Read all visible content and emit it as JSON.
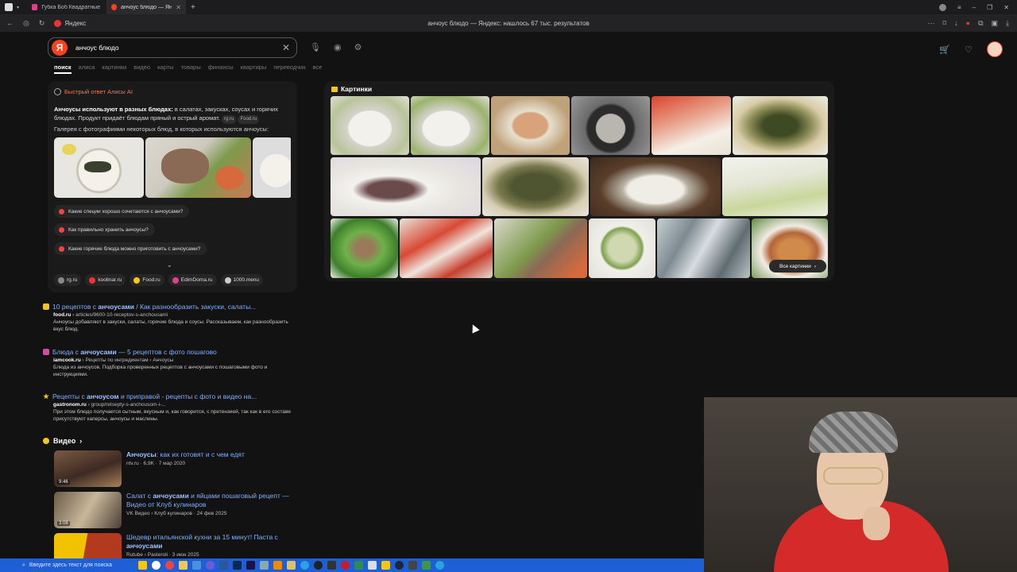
{
  "browser": {
    "tabs": [
      {
        "label": "Губка Боб Квадратные Ш"
      },
      {
        "label": "анчоус блюдо — Яндекс"
      }
    ],
    "site_label": "Яндекс",
    "page_title": "анчоус блюдо — Яндекс: нашлось 67 тыс. результатов"
  },
  "search": {
    "query": "анчоус блюдо",
    "logo": "Я"
  },
  "nav_tabs": [
    "поиск",
    "алиса",
    "картинки",
    "видео",
    "карты",
    "товары",
    "финансы",
    "квартиры",
    "переводчик",
    "все"
  ],
  "alice": {
    "header": "Быстрый ответ Алисы AI",
    "intro_bold": "Анчоусы используют в разных блюдах:",
    "intro_rest": " в салатах, закусках, соусах и горячих блюдах. Продукт придаёт блюдам пряный и острый аромат.",
    "chip1": "rg.ru",
    "chip2": "Food.ru",
    "gallery_caption": "Галерея с фотографиями некоторых блюд, в которых используются анчоусы:",
    "questions": [
      "Какие специи хорошо сочетаются с анчоусами?",
      "Как правильно хранить анчоусы?",
      "Какие горячие блюда можно приготовить с анчоусами?"
    ],
    "sources": [
      "rg.ru",
      "koolinar.ru",
      "Food.ru",
      "EdimDoma.ru",
      "1000.menu"
    ]
  },
  "results": [
    {
      "title_a": "10 рецептов с ",
      "title_b": "анчоусами",
      "title_c": " / Как разнообразить закуски, салаты...",
      "url_a": "food.ru",
      "url_b": " › articles/9600-10-receptov-s-anchousami",
      "desc": "Анчоусы добавляют в закуски, салаты, горячие блюда и соусы. Рассказываем, как разнообразить вкус блюд."
    },
    {
      "title_a": "Блюда с ",
      "title_b": "анчоусами",
      "title_c": " — 5 рецептов с фото пошагово",
      "url_a": "iamcook.ru",
      "url_b": " › Рецепты по ингредиентам › Анчоусы",
      "desc": "Блюда из анчоусов. Подборка проверенных рецептов с анчоусами с пошаговыми фото и инструкциями."
    },
    {
      "title_a": "Рецепты с ",
      "title_b": "анчоусом",
      "title_c": " и приправой - рецепты с фото и видео на...",
      "url_a": "gastronom.ru",
      "url_b": " › group/retsepty-s-anchousom-i-...",
      "desc": "При этом блюдо получается сытным, вкусным и, как говорится, с претензией, так как в его составе присутствуют каперсы, анчоусы и маслины."
    }
  ],
  "videos": {
    "heading": "Видео",
    "items": [
      {
        "title_b": "Анчоусы",
        "title_c": ": как их готовят и с чем едят",
        "meta": "ntv.ru · 6,9K · 7 мар 2020",
        "duration": "9:46"
      },
      {
        "title_a": "Салат с ",
        "title_b": "анчоусами",
        "title_c": " и яйцами пошаговый рецепт — Видео от Клуб кулинаров",
        "meta": "VK Видео › Клуб кулинаров · 24 фев 2025",
        "duration": "3:08"
      },
      {
        "title_a": "Шедевр итальянской кухни за 15 минут! Паста с ",
        "title_b": "анчоусами",
        "meta": "Rutube › Pasteroli · 3 июн 2025",
        "duration": ""
      }
    ]
  },
  "images": {
    "heading": "Картинки",
    "all_label": "Все картинки"
  },
  "taskbar": {
    "search_placeholder": "Введите здесь текст для поиска"
  },
  "colors": {
    "yandex_red": "#fc3f1d",
    "link": "#7fb0ff",
    "taskbar": "#1f5fd6"
  }
}
